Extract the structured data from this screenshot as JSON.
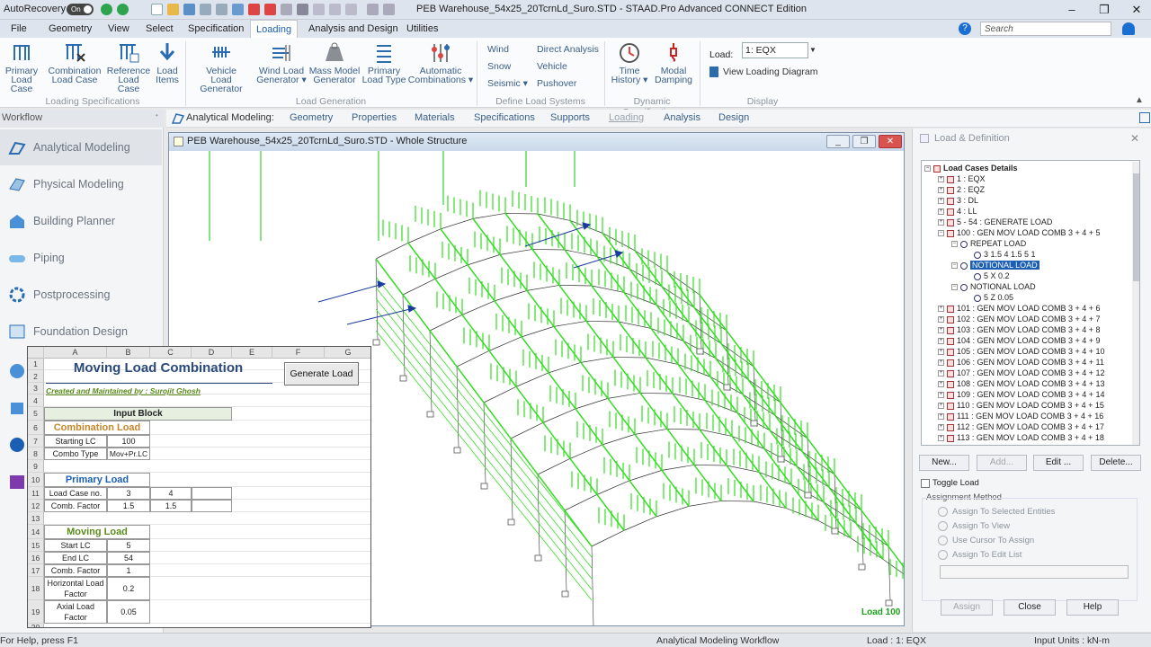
{
  "titlebar": {
    "autorecovery": "AutoRecovery",
    "toggle": "On",
    "window_title": "PEB Warehouse_54x25_20TcrnLd_Suro.STD - STAAD.Pro Advanced CONNECT Edition",
    "minimize": "–",
    "restore": "❐",
    "close": "✕"
  },
  "menu": {
    "items": [
      "File",
      "Geometry",
      "View",
      "Select",
      "Specification",
      "Loading",
      "Analysis and Design",
      "Utilities"
    ],
    "search_placeholder": "Search"
  },
  "ribbon": {
    "buttons": [
      {
        "label1": "Primary",
        "label2": "Load Case"
      },
      {
        "label1": "Combination",
        "label2": "Load Case"
      },
      {
        "label1": "Reference",
        "label2": "Load Case"
      },
      {
        "label1": "Load",
        "label2": "Items"
      },
      {
        "label1": "Vehicle",
        "label2": "Load Generator"
      },
      {
        "label1": "Wind Load",
        "label2": "Generator ▾"
      },
      {
        "label1": "Mass Model",
        "label2": "Generator"
      },
      {
        "label1": "Primary",
        "label2": "Load Type"
      },
      {
        "label1": "Automatic",
        "label2": "Combinations ▾"
      },
      {
        "label1": "Time",
        "label2": "History ▾"
      },
      {
        "label1": "Modal",
        "label2": "Damping"
      }
    ],
    "small": [
      "Wind",
      "Snow",
      "Seismic ▾",
      "Direct Analysis",
      "Vehicle",
      "Pushover"
    ],
    "groups": [
      "Loading Specifications",
      "Load Generation",
      "Define Load Systems",
      "Dynamic Specifications",
      "Display"
    ],
    "load_label": "Load:",
    "load_value": "1: EQX",
    "view_loading": "View Loading Diagram"
  },
  "workflow": {
    "title": "Workflow",
    "items": [
      "Analytical Modeling",
      "Physical Modeling",
      "Building Planner",
      "Piping",
      "Postprocessing",
      "Foundation Design"
    ]
  },
  "subtabs": [
    "Analytical Modeling:",
    "Geometry",
    "Properties",
    "Materials",
    "Specifications",
    "Supports",
    "Loading",
    "Analysis",
    "Design"
  ],
  "viewport": {
    "title": "PEB Warehouse_54x25_20TcrnLd_Suro.STD - Whole Structure",
    "load_label": "Load 100"
  },
  "sheet": {
    "columns": [
      "A",
      "B",
      "C",
      "D",
      "E",
      "F",
      "G"
    ],
    "title": "Moving Load Combination",
    "subtitle": "Created and Maintained by : Surojit Ghosh",
    "generate_btn": "Generate Load",
    "input_block": "Input Block",
    "combination_load": "Combination Load",
    "starting_lc_label": "Starting LC",
    "starting_lc_value": "100",
    "combo_type_label": "Combo Type",
    "combo_type_value": "Mov+Pr.LC",
    "primary_load": "Primary Load",
    "load_case_no_label": "Load Case no.",
    "load_case_no_1": "3",
    "load_case_no_2": "4",
    "comb_factor_label": "Comb. Factor",
    "comb_factor_1": "1.5",
    "comb_factor_2": "1.5",
    "moving_load": "Moving Load",
    "start_lc_label": "Start LC",
    "start_lc_value": "5",
    "end_lc_label": "End LC",
    "end_lc_value": "54",
    "moving_comb_factor_label": "Comb. Factor",
    "moving_comb_factor_value": "1",
    "horizontal_label1": "Horizontal Load",
    "horizontal_label2": "Factor",
    "horizontal_value": "0.2",
    "axial_label1": "Axial Load",
    "axial_label2": "Factor",
    "axial_value": "0.05",
    "row_numbers": [
      "1",
      "2",
      "3",
      "4",
      "5",
      "6",
      "7",
      "8",
      "9",
      "10",
      "11",
      "12",
      "13",
      "14",
      "15",
      "16",
      "17",
      "18",
      "19",
      "20"
    ]
  },
  "panel": {
    "title": "Load & Definition",
    "root": "Load Cases Details",
    "tree": [
      {
        "text": "1 : EQX"
      },
      {
        "text": "2 : EQZ"
      },
      {
        "text": "3 : DL"
      },
      {
        "text": "4 : LL"
      },
      {
        "text": "5 - 54 : GENERATE LOAD"
      },
      {
        "text": "100 : GEN MOV LOAD COMB 3 + 4 + 5"
      },
      {
        "text": "REPEAT LOAD"
      },
      {
        "text": "3 1.5 4 1.5 5 1"
      },
      {
        "text": "NOTIONAL LOAD"
      },
      {
        "text": "5 X 0.2"
      },
      {
        "text": "NOTIONAL LOAD"
      },
      {
        "text": "5 Z 0.05"
      },
      {
        "text": "101 : GEN MOV LOAD COMB 3 + 4 + 6"
      },
      {
        "text": "102 : GEN MOV LOAD COMB 3 + 4 + 7"
      },
      {
        "text": "103 : GEN MOV LOAD COMB 3 + 4 + 8"
      },
      {
        "text": "104 : GEN MOV LOAD COMB 3 + 4 + 9"
      },
      {
        "text": "105 : GEN MOV LOAD COMB 3 + 4 + 10"
      },
      {
        "text": "106 : GEN MOV LOAD COMB 3 + 4 + 11"
      },
      {
        "text": "107 : GEN MOV LOAD COMB 3 + 4 + 12"
      },
      {
        "text": "108 : GEN MOV LOAD COMB 3 + 4 + 13"
      },
      {
        "text": "109 : GEN MOV LOAD COMB 3 + 4 + 14"
      },
      {
        "text": "110 : GEN MOV LOAD COMB 3 + 4 + 15"
      },
      {
        "text": "111 : GEN MOV LOAD COMB 3 + 4 + 16"
      },
      {
        "text": "112 : GEN MOV LOAD COMB 3 + 4 + 17"
      },
      {
        "text": "113 : GEN MOV LOAD COMB 3 + 4 + 18"
      }
    ],
    "btn_new": "New...",
    "btn_add": "Add...",
    "btn_edit": "Edit ...",
    "btn_delete": "Delete...",
    "toggle_load": "Toggle Load",
    "assignment_method": "Assignment Method",
    "radios": [
      "Assign To Selected Entities",
      "Assign To View",
      "Use Cursor To Assign",
      "Assign To Edit List"
    ],
    "btn_assign": "Assign",
    "btn_close": "Close",
    "btn_help": "Help"
  },
  "status": {
    "help": "For Help, press F1",
    "workflow": "Analytical Modeling Workflow",
    "load": "Load : 1: EQX",
    "units": "Input Units : kN-m"
  }
}
